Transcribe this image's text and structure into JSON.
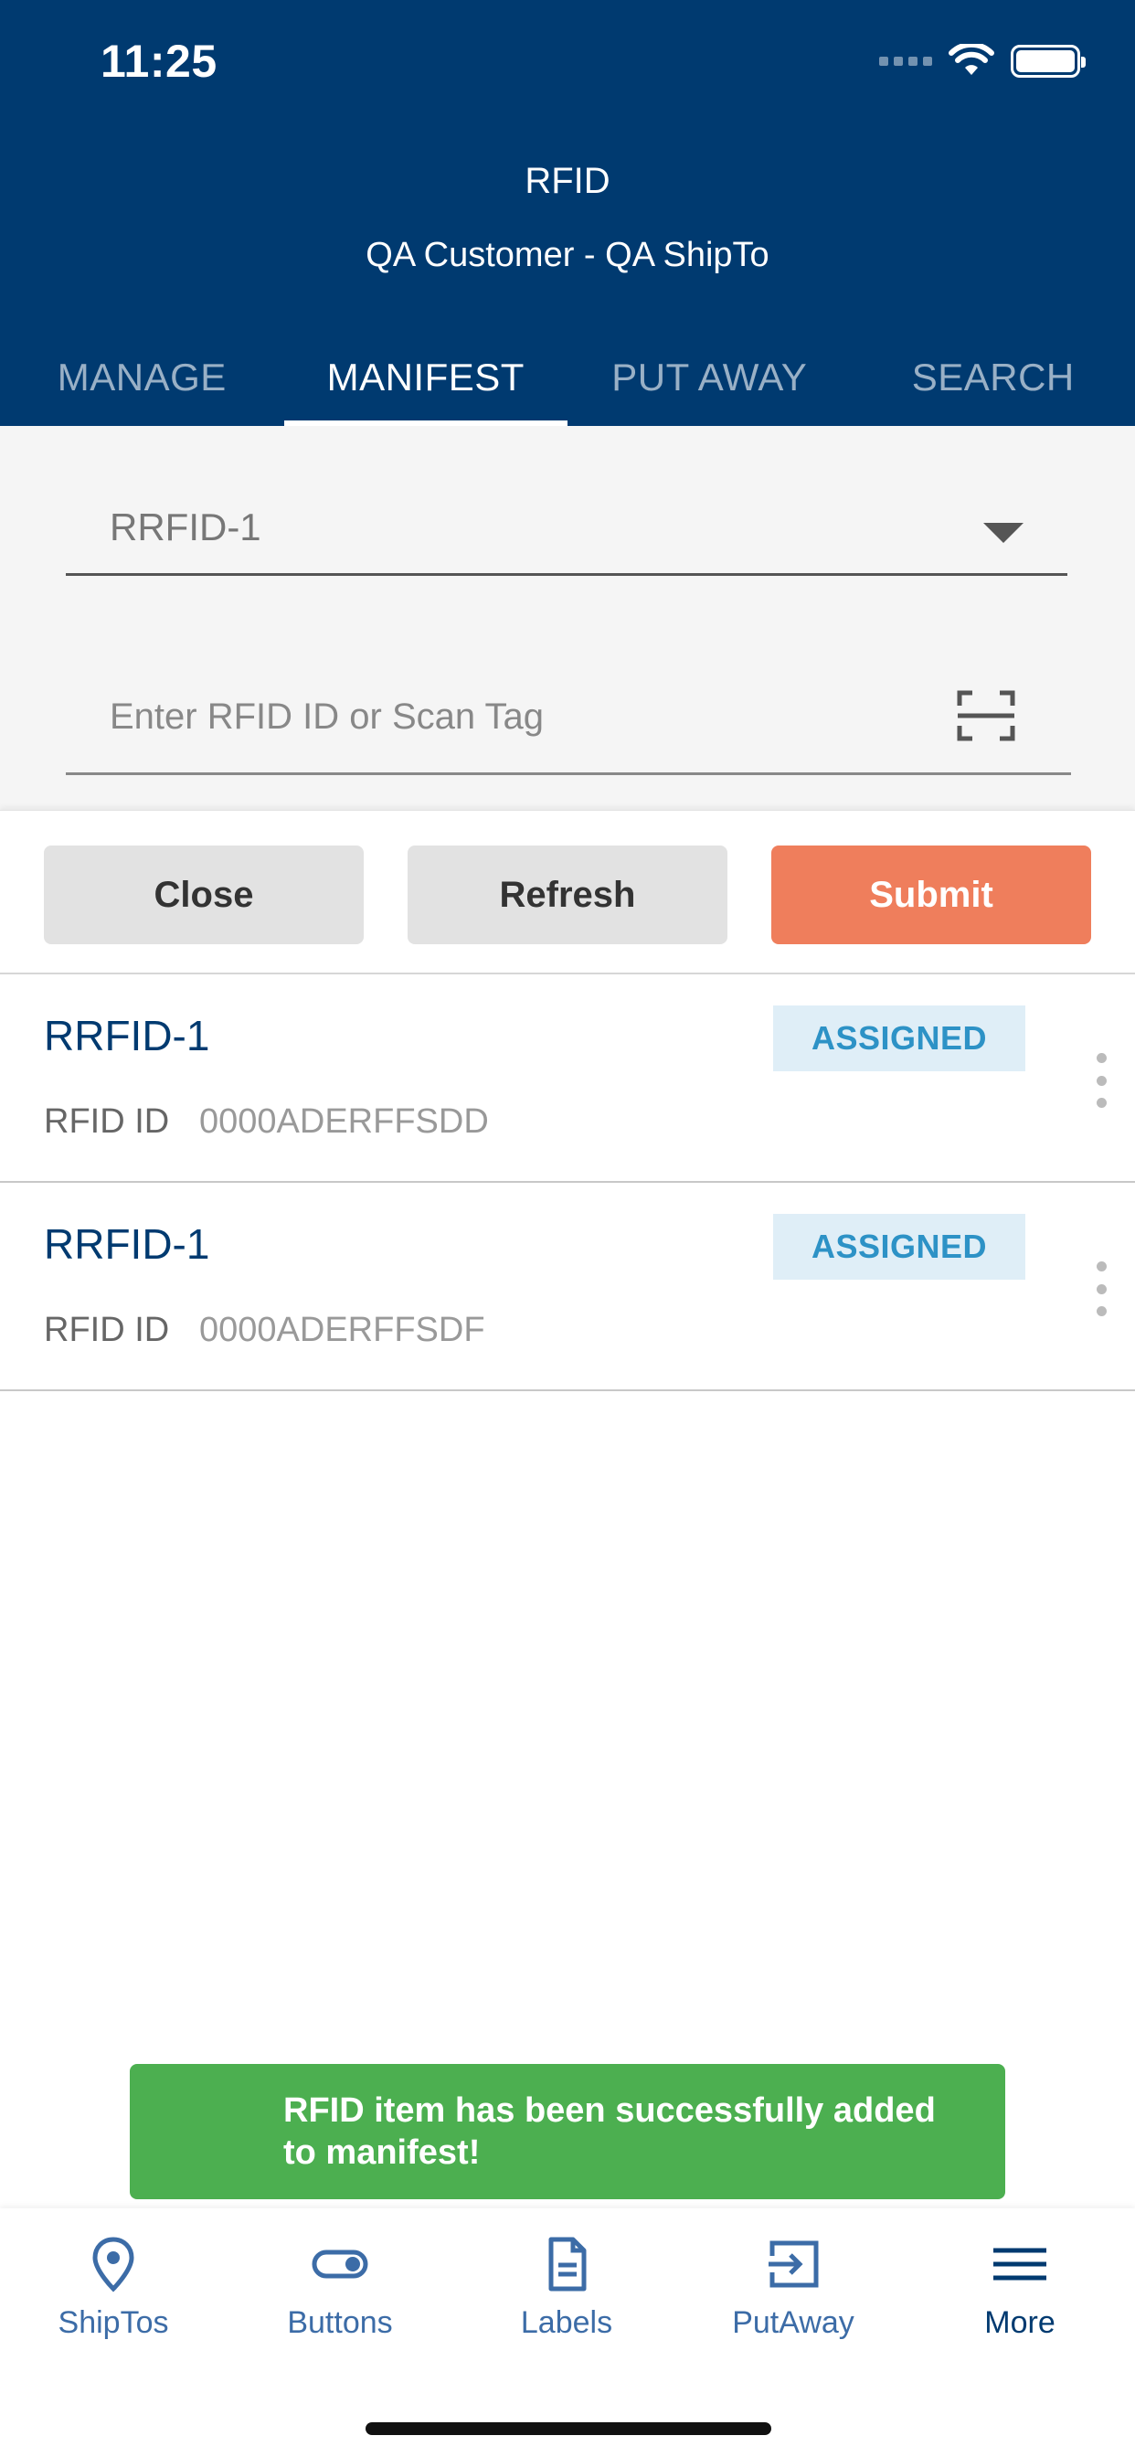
{
  "status_bar": {
    "time": "11:25"
  },
  "header": {
    "title": "RFID",
    "subtitle": "QA Customer - QA ShipTo"
  },
  "tabs": [
    {
      "label": "MANAGE",
      "active": false
    },
    {
      "label": "MANIFEST",
      "active": true
    },
    {
      "label": "PUT AWAY",
      "active": false
    },
    {
      "label": "SEARCH",
      "active": false
    }
  ],
  "form": {
    "select_value": "RRFID-1",
    "rfid_input": {
      "value": "",
      "placeholder": "Enter RFID ID or Scan Tag"
    }
  },
  "actions": {
    "close_label": "Close",
    "refresh_label": "Refresh",
    "submit_label": "Submit"
  },
  "items": [
    {
      "title": "RRFID-1",
      "status": "ASSIGNED",
      "id_label": "RFID ID",
      "id_value": "0000ADERFFSDD"
    },
    {
      "title": "RRFID-1",
      "status": "ASSIGNED",
      "id_label": "RFID ID",
      "id_value": "0000ADERFFSDF"
    }
  ],
  "toast": {
    "message": "RFID item has been successfully added to manifest!"
  },
  "bottom_nav": [
    {
      "label": "ShipTos",
      "icon": "map-pin-icon"
    },
    {
      "label": "Buttons",
      "icon": "toggle-icon"
    },
    {
      "label": "Labels",
      "icon": "document-icon"
    },
    {
      "label": "PutAway",
      "icon": "put-away-icon"
    },
    {
      "label": "More",
      "icon": "menu-icon",
      "active": true
    }
  ],
  "colors": {
    "header_bg": "#003a70",
    "submit_bg": "#ef7e5c",
    "toast_bg": "#4caf50",
    "badge_bg": "#dfeef7",
    "badge_text": "#2d92c6"
  }
}
